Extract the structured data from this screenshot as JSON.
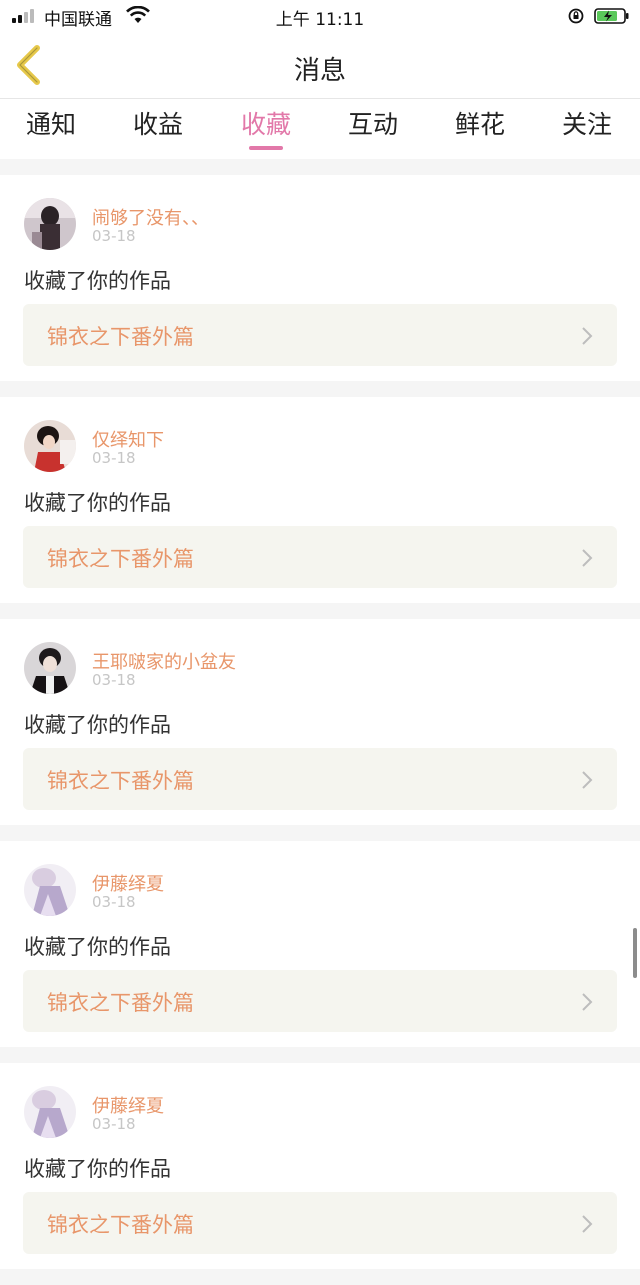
{
  "status_bar": {
    "carrier": "中国联通",
    "time": "上午 11:11"
  },
  "header": {
    "title": "消息",
    "back_icon": "chevron-left-icon"
  },
  "tabs": [
    {
      "label": "通知",
      "active": false
    },
    {
      "label": "收益",
      "active": false
    },
    {
      "label": "收藏",
      "active": true
    },
    {
      "label": "互动",
      "active": false
    },
    {
      "label": "鲜花",
      "active": false
    },
    {
      "label": "关注",
      "active": false
    }
  ],
  "colors": {
    "accent": "#e278a9",
    "username": "#e8966a",
    "work_bg": "#f5f5ef"
  },
  "items": [
    {
      "username": "闹够了没有、、",
      "date": "03-18",
      "action": "收藏了你的作品",
      "work_title": "锦衣之下番外篇"
    },
    {
      "username": "仅绎知下",
      "date": "03-18",
      "action": "收藏了你的作品",
      "work_title": "锦衣之下番外篇"
    },
    {
      "username": "王耶啵家的小盆友",
      "date": "03-18",
      "action": "收藏了你的作品",
      "work_title": "锦衣之下番外篇"
    },
    {
      "username": "伊藤绎夏",
      "date": "03-18",
      "action": "收藏了你的作品",
      "work_title": "锦衣之下番外篇"
    },
    {
      "username": "伊藤绎夏",
      "date": "03-18",
      "action": "收藏了你的作品",
      "work_title": "锦衣之下番外篇"
    }
  ]
}
